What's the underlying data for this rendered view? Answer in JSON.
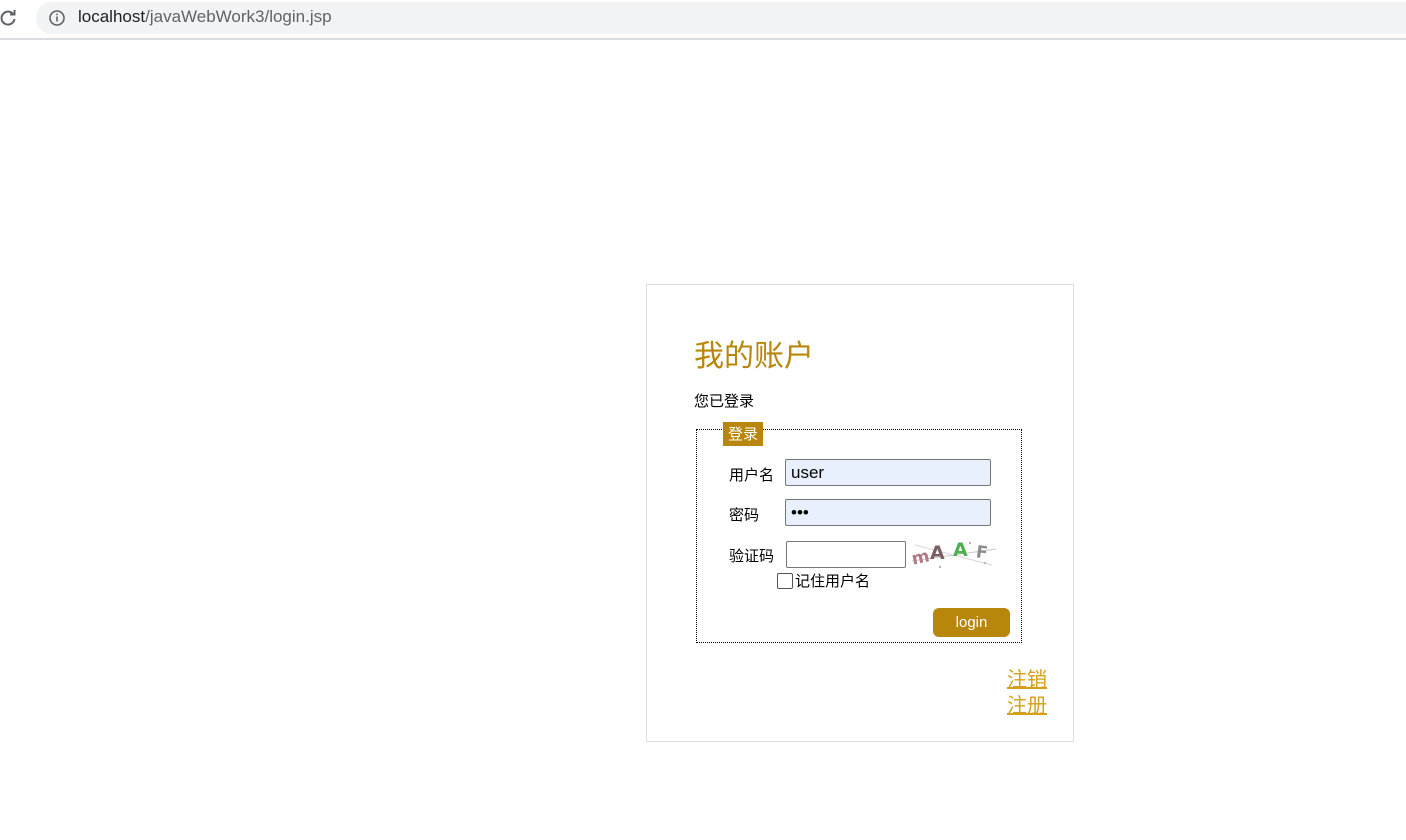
{
  "browser": {
    "url_host": "localhost",
    "url_path": "/javaWebWork3/login.jsp",
    "reload_icon": "reload-icon",
    "info_icon": "info-icon"
  },
  "account": {
    "title": "我的账户",
    "status": "您已登录"
  },
  "login_form": {
    "legend": "登录",
    "username_label": "用户名",
    "username_value": "user",
    "password_label": "密码",
    "password_value": "•••",
    "captcha_label": "验证码",
    "captcha_value": "",
    "captcha_text": "mAAF",
    "remember_label": "记住用户名",
    "remember_checked": false,
    "login_button": "login"
  },
  "links": {
    "logout": "注销",
    "register": "注册"
  },
  "colors": {
    "accent": "#b8860b",
    "link": "#d4a017",
    "autofill": "#e8f0fe"
  }
}
